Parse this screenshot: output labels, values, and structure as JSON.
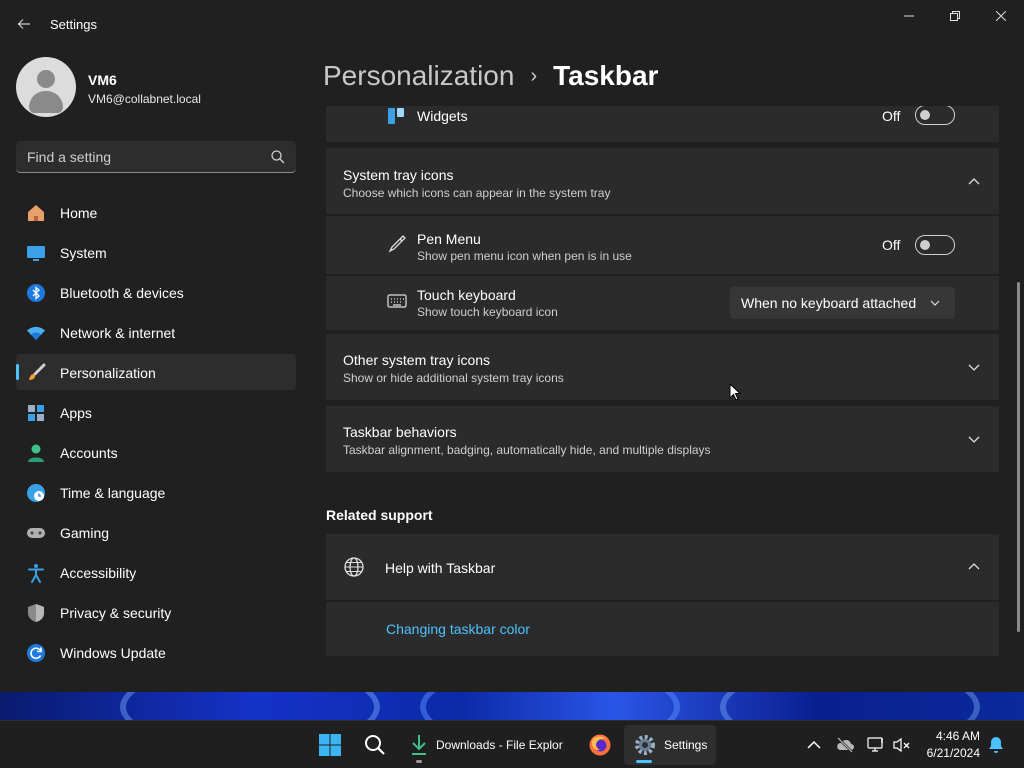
{
  "window": {
    "title": "Settings"
  },
  "profile": {
    "name": "VM6",
    "email": "VM6@collabnet.local"
  },
  "search": {
    "placeholder": "Find a setting"
  },
  "sidebar": {
    "items": [
      {
        "label": "Home",
        "icon": "home-icon"
      },
      {
        "label": "System",
        "icon": "monitor-icon"
      },
      {
        "label": "Bluetooth & devices",
        "icon": "bluetooth-icon"
      },
      {
        "label": "Network & internet",
        "icon": "wifi-icon"
      },
      {
        "label": "Personalization",
        "icon": "paintbrush-icon",
        "active": true
      },
      {
        "label": "Apps",
        "icon": "apps-icon"
      },
      {
        "label": "Accounts",
        "icon": "person-icon"
      },
      {
        "label": "Time & language",
        "icon": "clock-globe-icon"
      },
      {
        "label": "Gaming",
        "icon": "gamepad-icon"
      },
      {
        "label": "Accessibility",
        "icon": "accessibility-icon"
      },
      {
        "label": "Privacy & security",
        "icon": "shield-icon"
      },
      {
        "label": "Windows Update",
        "icon": "update-icon"
      }
    ]
  },
  "breadcrumb": {
    "parent": "Personalization",
    "separator": "›",
    "current": "Taskbar"
  },
  "widgets": {
    "label": "Widgets",
    "state": "Off"
  },
  "system_tray": {
    "title": "System tray icons",
    "description": "Choose which icons can appear in the system tray",
    "pen_menu": {
      "title": "Pen Menu",
      "description": "Show pen menu icon when pen is in use",
      "state": "Off"
    },
    "touch_keyboard": {
      "title": "Touch keyboard",
      "description": "Show touch keyboard icon",
      "value": "When no keyboard attached"
    }
  },
  "other_tray": {
    "title": "Other system tray icons",
    "description": "Show or hide additional system tray icons"
  },
  "behaviors": {
    "title": "Taskbar behaviors",
    "description": "Taskbar alignment, badging, automatically hide, and multiple displays"
  },
  "related": {
    "heading": "Related support",
    "help_title": "Help with Taskbar",
    "link": "Changing taskbar color"
  },
  "taskbar": {
    "downloads_label": "Downloads - File Explor",
    "settings_label": "Settings",
    "time": "4:46 AM",
    "date": "6/21/2024"
  },
  "colors": {
    "accent": "#4cc2ff",
    "card": "#2b2b2b",
    "background": "#202020"
  }
}
